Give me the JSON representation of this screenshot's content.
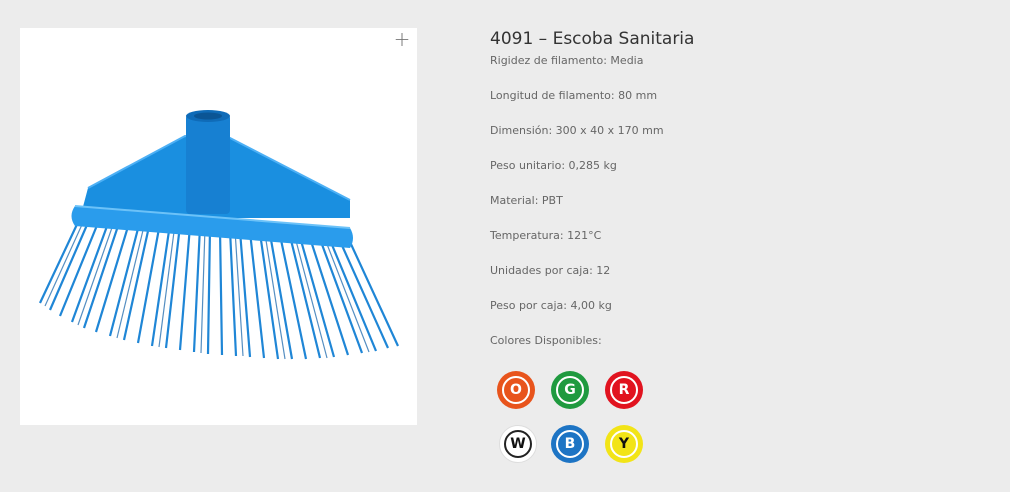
{
  "product": {
    "title": "4091 – Escoba Sanitaria",
    "zoom_icon": "plus-icon",
    "specs": [
      "Rigidez de filamento: Media",
      "Longitud de filamento: 80 mm",
      "Dimensión: 300 x 40 x 170 mm",
      "Peso unitario: 0,285 kg",
      "Material: PBT",
      "Temperatura: 121°C",
      "Unidades por caja: 12",
      "Peso por caja: 4,00 kg"
    ],
    "colors_label": "Colores Disponibles:",
    "colors": [
      {
        "letter": "O",
        "hex": "#e8541c",
        "text": "#ffffff"
      },
      {
        "letter": "G",
        "hex": "#1f9a3f",
        "text": "#ffffff"
      },
      {
        "letter": "R",
        "hex": "#e1131f",
        "text": "#ffffff"
      },
      {
        "letter": "W",
        "hex": "#ffffff",
        "text": "#111111"
      },
      {
        "letter": "B",
        "hex": "#1d74c4",
        "text": "#ffffff"
      },
      {
        "letter": "Y",
        "hex": "#f2e417",
        "text": "#111111"
      }
    ],
    "broom_color": "#1a8fe0"
  }
}
